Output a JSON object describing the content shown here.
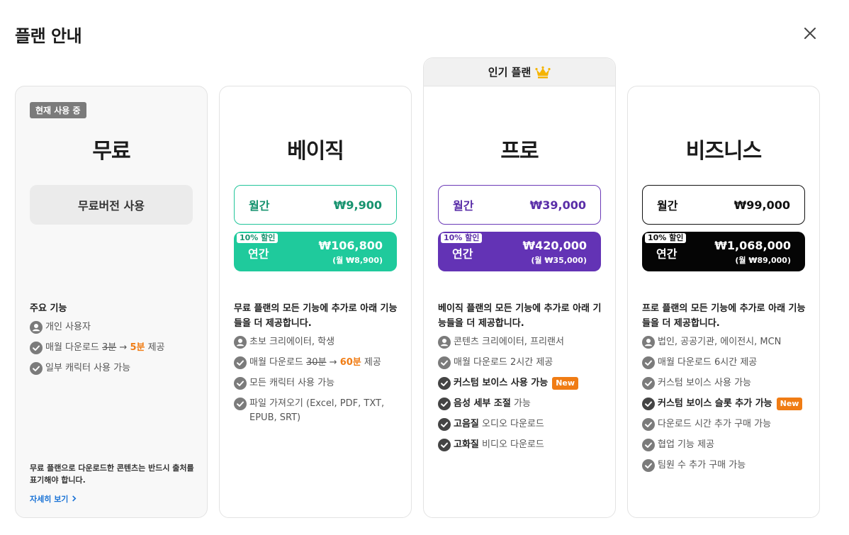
{
  "title": "플랜 안내",
  "popular_label": "인기 플랜",
  "free": {
    "current_badge": "현재 사용 중",
    "name": "무료",
    "button": "무료버전 사용",
    "features_title": "주요 기능",
    "f1": "개인 사용자",
    "f2_pre": "매월 다운로드 ",
    "f2_old": "3분",
    "f2_arrow": " → ",
    "f2_new": "5분",
    "f2_post": " 제공",
    "f3": "일부 캐릭터 사용 가능",
    "notice": "무료 플랜으로 다운로드한 콘텐츠는 반드시 출처를 표기해야 합니다.",
    "more": "자세히 보기"
  },
  "basic": {
    "name": "베이직",
    "monthly_label": "월간",
    "monthly_price": "₩9,900",
    "discount": "10% 할인",
    "yearly_label": "연간",
    "yearly_price": "₩106,800",
    "yearly_sub": "(월 ₩8,900)",
    "intro": "무료 플랜의 모든 기능에 추가로 아래 기능들을 더 제공합니다.",
    "f1": "초보 크리에이터, 학생",
    "f2_pre": "매월 다운로드 ",
    "f2_old": "30분",
    "f2_arrow": " → ",
    "f2_new": "60분",
    "f2_post": " 제공",
    "f3": "모든 캐릭터 사용 가능",
    "f4": "파일 가져오기 (Excel, PDF, TXT, EPUB, SRT)"
  },
  "pro": {
    "name": "프로",
    "monthly_label": "월간",
    "monthly_price": "₩39,000",
    "discount": "10% 할인",
    "yearly_label": "연간",
    "yearly_price": "₩420,000",
    "yearly_sub": "(월 ₩35,000)",
    "intro": "베이직 플랜의 모든 기능에 추가로 아래 기능들을 더 제공합니다.",
    "f1": "콘텐츠 크리에이터, 프리랜서",
    "f2": "매월 다운로드 2시간  제공",
    "f3": "커스텀 보이스 사용 가능",
    "f3_tag": "New",
    "f4_b": "음성 세부 조절",
    "f4": " 가능",
    "f5_b": "고음질",
    "f5": " 오디오 다운로드",
    "f6_b": "고화질",
    "f6": " 비디오 다운로드"
  },
  "biz": {
    "name": "비즈니스",
    "monthly_label": "월간",
    "monthly_price": "₩99,000",
    "discount": "10% 할인",
    "yearly_label": "연간",
    "yearly_price": "₩1,068,000",
    "yearly_sub": "(월 ₩89,000)",
    "intro": "프로 플랜의 모든 기능에 추가로 아래 기능들을 더 제공합니다.",
    "f1": "법인, 공공기관, 에이전시, MCN",
    "f2": "매월 다운로드 6시간  제공",
    "f3": "커스텀 보이스 사용 가능",
    "f4": "커스텀 보이스 슬롯 추가 가능",
    "f4_tag": "New",
    "f5": "다운로드 시간 추가 구매 가능",
    "f6": "협업 기능 제공",
    "f7": "팀원 수 추가 구매 가능"
  },
  "colors": {
    "basic": "#1fca9c",
    "pro": "#6333b5",
    "business": "#050505",
    "accent_orange": "#f07c14",
    "link": "#1a73d6"
  },
  "icons": [
    "close-icon",
    "crown-icon",
    "user-icon",
    "check-icon",
    "chevron-right-icon"
  ]
}
